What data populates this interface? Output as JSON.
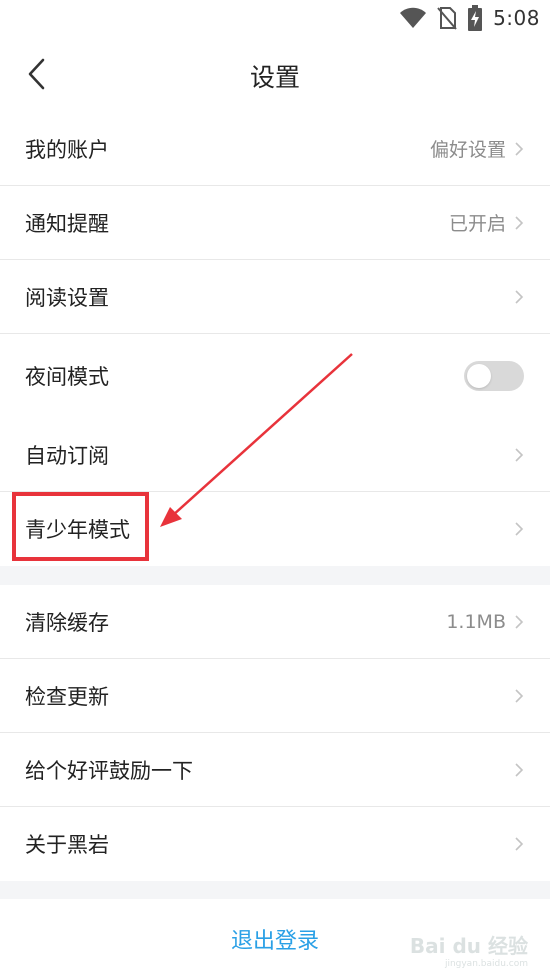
{
  "status_bar": {
    "time": "5:08",
    "icons": [
      "wifi-icon",
      "no-sim-icon",
      "battery-charging-icon"
    ]
  },
  "header": {
    "title": "设置",
    "back_icon": "chevron-left-icon"
  },
  "groups": [
    {
      "items": [
        {
          "label": "我的账户",
          "value": "偏好设置",
          "chevron": true
        },
        {
          "label": "通知提醒",
          "value": "已开启",
          "chevron": true
        },
        {
          "label": "阅读设置",
          "value": "",
          "chevron": true
        },
        {
          "label": "夜间模式",
          "toggle": false
        }
      ]
    },
    {
      "items": [
        {
          "label": "自动订阅",
          "value": "",
          "chevron": true
        },
        {
          "label": "青少年模式",
          "value": "",
          "chevron": true,
          "highlighted": true
        }
      ]
    },
    {
      "items": [
        {
          "label": "清除缓存",
          "value": "1.1MB",
          "chevron": true
        },
        {
          "label": "检查更新",
          "value": "",
          "chevron": true
        },
        {
          "label": "给个好评鼓励一下",
          "value": "",
          "chevron": true
        },
        {
          "label": "关于黑岩",
          "value": "",
          "chevron": true
        }
      ]
    }
  ],
  "logout": {
    "label": "退出登录"
  },
  "watermark": {
    "logo": "Bai du 经验",
    "url": "jingyan.baidu.com"
  },
  "colors": {
    "accent": "#2aa0e6",
    "annotation_red": "#e8333b",
    "background": "#f4f5f7"
  }
}
